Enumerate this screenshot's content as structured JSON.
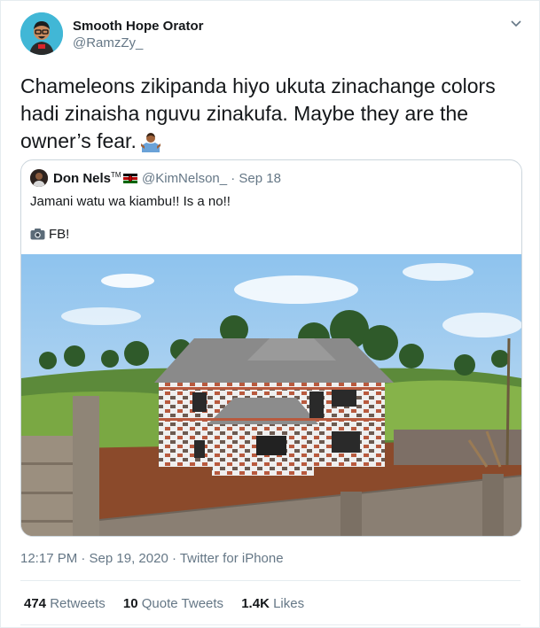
{
  "author": {
    "name": "Smooth Hope Orator",
    "handle": "@RamzZy_"
  },
  "tweet": {
    "text": "Chameleons zikipanda hiyo ukuta zinachange colors hadi zinaisha nguvu zinakufa. Maybe they are the owner’s fear.",
    "emoji": "person-shrugging-emoji"
  },
  "quoted": {
    "name": "Don Nels",
    "name_suffix": "TM",
    "flag": "kenya-flag-emoji",
    "handle_date": "@KimNelson_ · Sep 18",
    "text": "Jamani watu wa kiambu!!  Is a no!!",
    "fb": "FB!",
    "image": "photo of a two-storey house with a brick-and-white striped exterior wall pattern, green fields and trees behind, unfinished stone wall in foreground"
  },
  "meta": {
    "time": "12:17 PM · Sep 19, 2020 · ",
    "source": "Twitter for iPhone"
  },
  "stats": {
    "retweets_count": "474",
    "retweets_label": "Retweets",
    "quotes_count": "10",
    "quotes_label": "Quote Tweets",
    "likes_count": "1.4K",
    "likes_label": "Likes"
  },
  "colors": {
    "text": "#14171a",
    "secondary": "#657786",
    "border": "#e6ecf0"
  }
}
